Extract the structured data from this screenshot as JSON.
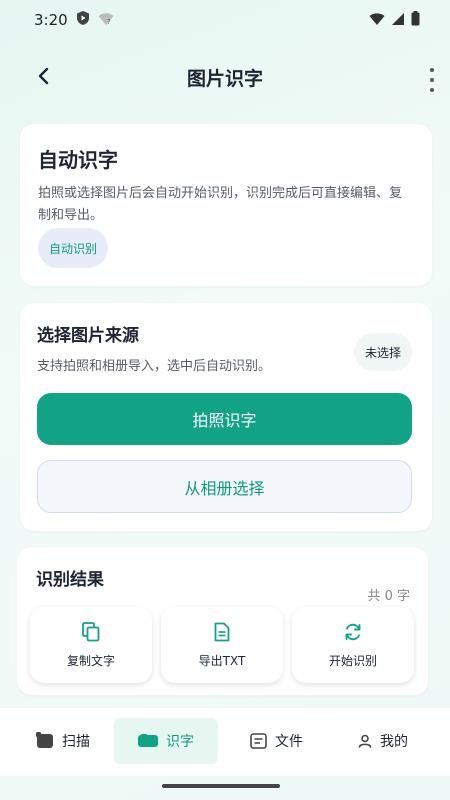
{
  "status_bar": {
    "time": "3:20"
  },
  "header": {
    "title": "图片识字"
  },
  "auto_card": {
    "title": "自动识字",
    "description": "拍照或选择图片后会自动开始识别，识别完成后可直接编辑、复制和导出。",
    "chip": "自动识别"
  },
  "source_card": {
    "title": "选择图片来源",
    "description": "支持拍照和相册导入，选中后自动识别。",
    "status_chip": "未选择",
    "camera_button": "拍照识字",
    "album_button": "从相册选择"
  },
  "result_card": {
    "title": "识别结果",
    "count": "共 0 字"
  },
  "actions": [
    {
      "label": "复制文字",
      "icon": "copy-icon"
    },
    {
      "label": "导出TXT",
      "icon": "document-icon"
    },
    {
      "label": "开始识别",
      "icon": "refresh-icon"
    }
  ],
  "bottom_nav": [
    {
      "label": "扫描",
      "icon": "scan-icon",
      "active": false
    },
    {
      "label": "识字",
      "icon": "text-recognition-icon",
      "active": true
    },
    {
      "label": "文件",
      "icon": "file-icon",
      "active": false
    },
    {
      "label": "我的",
      "icon": "person-icon",
      "active": false
    }
  ],
  "colors": {
    "accent": "#12a387",
    "accent_text": "#12997f",
    "background": "#e6f6f1",
    "card": "#ffffff"
  }
}
